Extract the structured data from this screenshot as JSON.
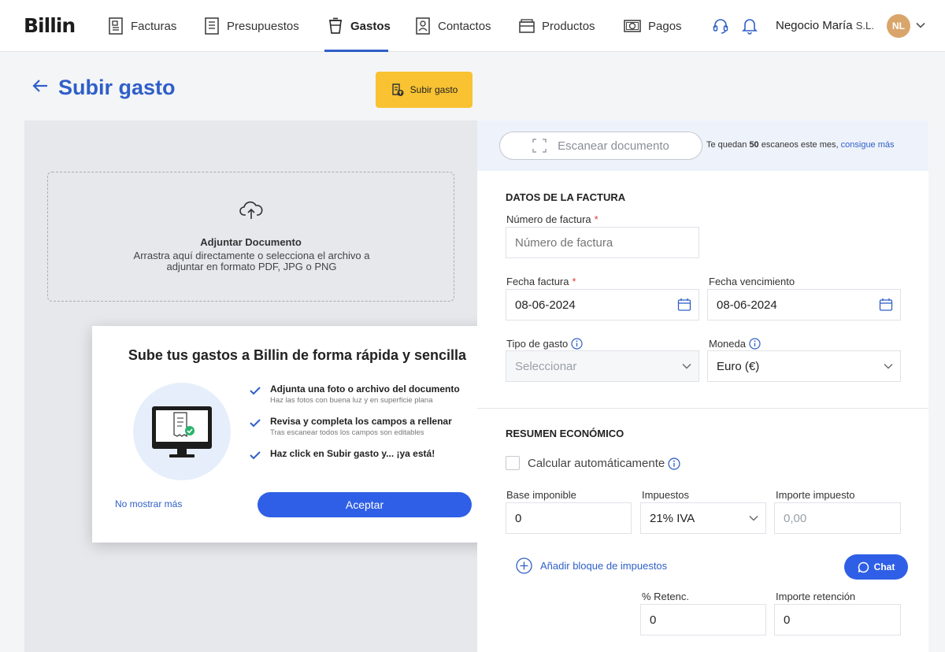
{
  "app": {
    "logo": "Billin"
  },
  "nav": {
    "items": [
      {
        "label": "Facturas",
        "icon": "invoice-icon"
      },
      {
        "label": "Presupuestos",
        "icon": "quote-icon"
      },
      {
        "label": "Gastos",
        "icon": "expense-cup-icon",
        "active": true
      },
      {
        "label": "Contactos",
        "icon": "contacts-icon"
      },
      {
        "label": "Productos",
        "icon": "products-box-icon"
      },
      {
        "label": "Pagos",
        "icon": "payments-icon"
      }
    ],
    "company": "Negocio María",
    "company_suffix": "S.L.",
    "avatar_initials": "NL"
  },
  "page": {
    "title": "Subir gasto",
    "upload_button": "Subir gasto"
  },
  "dropzone": {
    "title": "Adjuntar Documento",
    "desc": "Arrastra aquí directamente o selecciona el archivo a adjuntar en formato PDF, JPG o PNG"
  },
  "modal": {
    "title": "Sube tus gastos a Billin de forma rápida y sencilla",
    "steps": [
      {
        "title": "Adjunta una foto o archivo del documento",
        "sub": "Haz las fotos con buena luz y en superficie plana"
      },
      {
        "title": "Revisa y completa los campos a rellenar",
        "sub": "Tras escanear todos los campos son editables"
      },
      {
        "title": "Haz click en Subir gasto y... ¡ya está!",
        "sub": ""
      }
    ],
    "no_more": "No mostrar más",
    "accept": "Aceptar"
  },
  "scan": {
    "button": "Escanear documento",
    "info_prefix": "Te quedan ",
    "info_count": "50",
    "info_mid": " escaneos este mes, ",
    "info_link": "consigue más"
  },
  "invoice": {
    "section_title": "DATOS DE LA FACTURA",
    "number_label": "Número de factura",
    "number_placeholder": "Número de factura",
    "date_label": "Fecha factura",
    "date_value": "08-06-2024",
    "due_label": "Fecha vencimiento",
    "due_value": "08-06-2024",
    "type_label": "Tipo de gasto",
    "type_placeholder": "Seleccionar",
    "currency_label": "Moneda",
    "currency_value": "Euro (€)"
  },
  "summary": {
    "section_title": "RESUMEN ECONÓMICO",
    "auto_label": "Calcular automáticamente",
    "base_label": "Base imponible",
    "base_value": "0",
    "tax_label": "Impuestos",
    "tax_value": "21% IVA",
    "tax_amount_label": "Importe impuesto",
    "tax_amount_placeholder": "0,00",
    "add_tax": "Añadir bloque de impuestos",
    "ret_label": "% Retenc.",
    "ret_value": "0",
    "ret_amount_label": "Importe retención",
    "ret_amount_value": "0"
  },
  "chat": {
    "label": "Chat"
  },
  "colors": {
    "primary": "#2f5fc8",
    "button_blue": "#2f5fe6",
    "upload_yellow": "#f8c232"
  }
}
